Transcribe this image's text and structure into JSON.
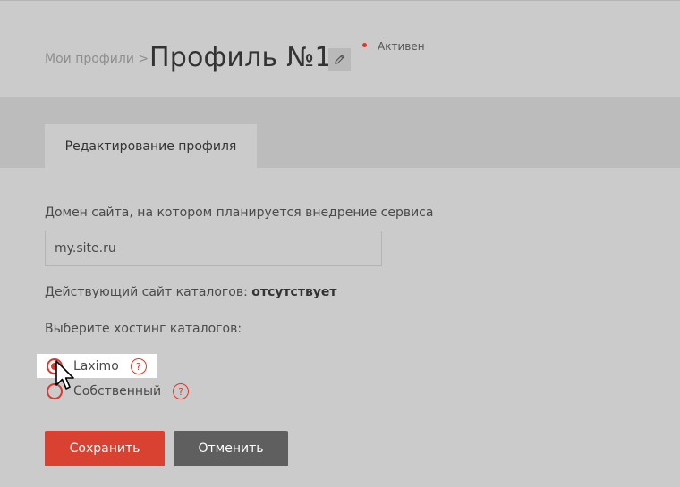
{
  "header": {
    "breadcrumb": "Мои профили >",
    "title": "Профиль №1",
    "status": "Активен",
    "status_color": "#e0372b"
  },
  "tabs": [
    {
      "label": "Редактирование профиля",
      "active": true
    }
  ],
  "form": {
    "domain_label": "Домен сайта, на котором планируется внедрение сервиса",
    "domain_value": "my.site.ru",
    "current_site_label": "Действующий сайт каталогов:",
    "current_site_value": "отсутствует",
    "hosting_label": "Выберите хостинг каталогов:",
    "hosting_options": [
      {
        "label": "Laximo",
        "checked": true,
        "help": "?"
      },
      {
        "label": "Собственный",
        "checked": false,
        "help": "?"
      }
    ]
  },
  "buttons": {
    "save_label": "Сохранить",
    "cancel_label": "Отменить"
  },
  "colors": {
    "accent": "#e0372b",
    "save_button": "#d94131",
    "cancel_button": "#5f5f5f"
  },
  "icons": {
    "edit": "pencil-icon",
    "help": "question-circle-icon",
    "cursor": "mouse-pointer-icon"
  }
}
